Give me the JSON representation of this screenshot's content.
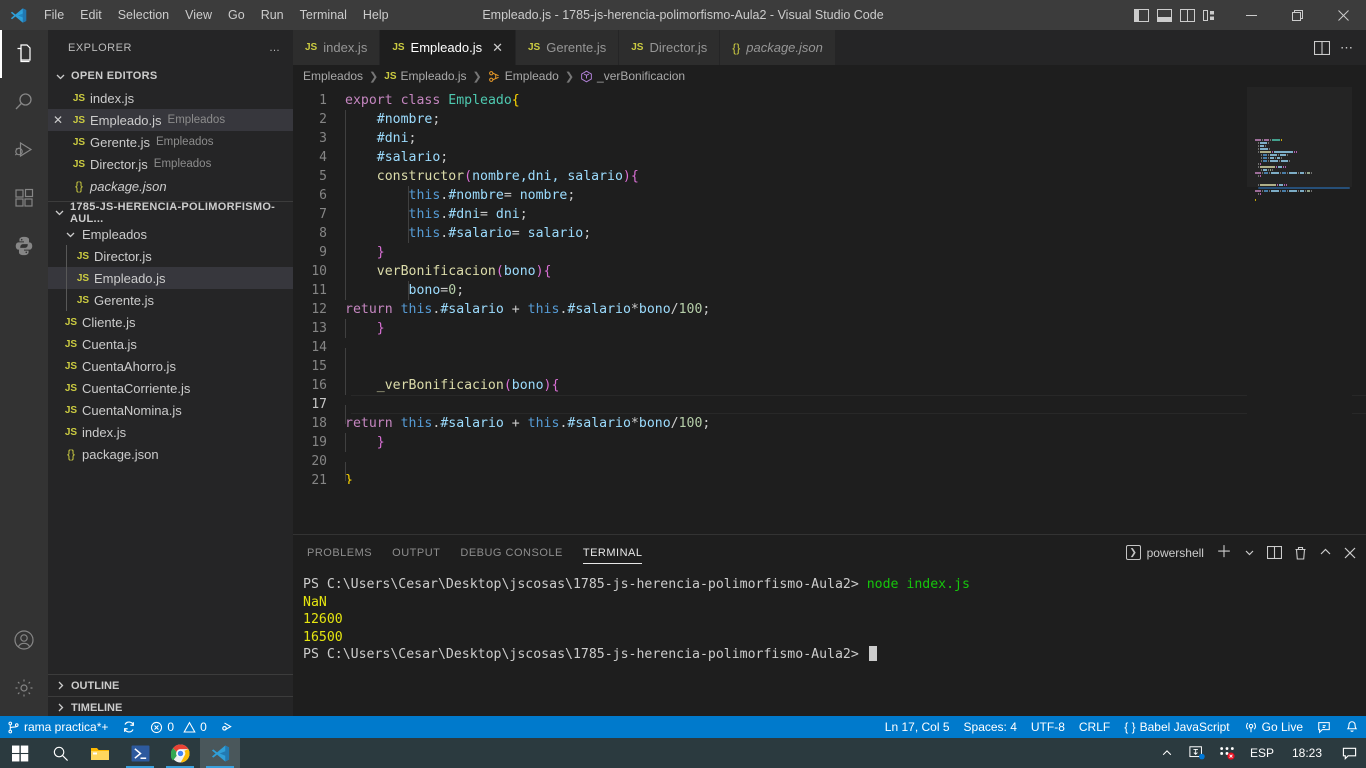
{
  "titlebar": {
    "menus": [
      "File",
      "Edit",
      "Selection",
      "View",
      "Go",
      "Run",
      "Terminal",
      "Help"
    ],
    "window_title": "Empleado.js - 1785-js-herencia-polimorfismo-Aula2 - Visual Studio Code",
    "layout_icons": [
      "toggle-primary-sidebar-icon",
      "toggle-panel-icon",
      "toggle-secondary-sidebar-icon",
      "customize-layout-icon"
    ],
    "window_controls": [
      "minimize",
      "restore",
      "close"
    ]
  },
  "activitybar": {
    "items": [
      {
        "name": "explorer",
        "icon": "files-icon",
        "active": true
      },
      {
        "name": "search",
        "icon": "search-icon",
        "active": false
      },
      {
        "name": "run-and-debug",
        "icon": "debug-icon",
        "active": false
      },
      {
        "name": "extensions",
        "icon": "extensions-icon",
        "active": false
      },
      {
        "name": "python",
        "icon": "python-icon",
        "active": false
      }
    ],
    "bottom": [
      {
        "name": "accounts",
        "icon": "account-icon"
      },
      {
        "name": "manage",
        "icon": "gear-icon"
      }
    ]
  },
  "sidebar": {
    "title": "EXPLORER",
    "more_actions": "…",
    "open_editors": {
      "label": "OPEN EDITORS",
      "items": [
        {
          "icon": "JS",
          "name": "index.js",
          "desc": "",
          "selected": false,
          "closable": false,
          "italic": false
        },
        {
          "icon": "JS",
          "name": "Empleado.js",
          "desc": "Empleados",
          "selected": true,
          "closable": true,
          "italic": false
        },
        {
          "icon": "JS",
          "name": "Gerente.js",
          "desc": "Empleados",
          "selected": false,
          "closable": false,
          "italic": false
        },
        {
          "icon": "JS",
          "name": "Director.js",
          "desc": "Empleados",
          "selected": false,
          "closable": false,
          "italic": false
        },
        {
          "icon": "{}",
          "name": "package.json",
          "desc": "",
          "selected": false,
          "closable": false,
          "italic": true
        }
      ]
    },
    "workspace": {
      "label": "1785-JS-HERENCIA-POLIMORFISMO-AUL...",
      "items": [
        {
          "type": "folder",
          "icon": "chevron-down-icon",
          "name": "Empleados",
          "indent": 1,
          "selected": false
        },
        {
          "type": "file",
          "icon": "JS",
          "name": "Director.js",
          "indent": 2,
          "selected": false
        },
        {
          "type": "file",
          "icon": "JS",
          "name": "Empleado.js",
          "indent": 2,
          "selected": true
        },
        {
          "type": "file",
          "icon": "JS",
          "name": "Gerente.js",
          "indent": 2,
          "selected": false
        },
        {
          "type": "file",
          "icon": "JS",
          "name": "Cliente.js",
          "indent": 1,
          "selected": false
        },
        {
          "type": "file",
          "icon": "JS",
          "name": "Cuenta.js",
          "indent": 1,
          "selected": false
        },
        {
          "type": "file",
          "icon": "JS",
          "name": "CuentaAhorro.js",
          "indent": 1,
          "selected": false
        },
        {
          "type": "file",
          "icon": "JS",
          "name": "CuentaCorriente.js",
          "indent": 1,
          "selected": false
        },
        {
          "type": "file",
          "icon": "JS",
          "name": "CuentaNomina.js",
          "indent": 1,
          "selected": false
        },
        {
          "type": "file",
          "icon": "JS",
          "name": "index.js",
          "indent": 1,
          "selected": false
        },
        {
          "type": "file",
          "icon": "{}",
          "name": "package.json",
          "indent": 1,
          "selected": false
        }
      ]
    },
    "collapsed_sections": [
      "OUTLINE",
      "TIMELINE"
    ]
  },
  "editor": {
    "tabs": [
      {
        "icon": "JS",
        "label": "index.js",
        "active": false,
        "dirty": false,
        "italic": false
      },
      {
        "icon": "JS",
        "label": "Empleado.js",
        "active": true,
        "dirty": false,
        "italic": false,
        "close": "✕"
      },
      {
        "icon": "JS",
        "label": "Gerente.js",
        "active": false,
        "dirty": false,
        "italic": false
      },
      {
        "icon": "JS",
        "label": "Director.js",
        "active": false,
        "dirty": false,
        "italic": false
      },
      {
        "icon": "{}",
        "label": "package.json",
        "active": false,
        "dirty": false,
        "italic": true
      }
    ],
    "tab_actions": [
      "split-editor-icon",
      "more-actions-icon"
    ],
    "breadcrumbs": [
      {
        "icon": "",
        "label": "Empleados"
      },
      {
        "icon": "JS",
        "label": "Empleado.js"
      },
      {
        "icon": "class-icon",
        "label": "Empleado"
      },
      {
        "icon": "method-icon",
        "label": "_verBonificacion"
      }
    ],
    "current_line": 17,
    "lines": [
      {
        "n": 1,
        "indent": 0,
        "tokens": [
          {
            "t": "export",
            "c": "k"
          },
          {
            "t": " ",
            "c": "pun"
          },
          {
            "t": "class",
            "c": "k"
          },
          {
            "t": " ",
            "c": "pun"
          },
          {
            "t": "Empleado",
            "c": "cls"
          },
          {
            "t": "{",
            "c": "br1"
          }
        ]
      },
      {
        "n": 2,
        "indent": 1,
        "tokens": [
          {
            "t": "    ",
            "c": "pun"
          },
          {
            "t": "#nombre",
            "c": "var"
          },
          {
            "t": ";",
            "c": "pun"
          }
        ]
      },
      {
        "n": 3,
        "indent": 1,
        "tokens": [
          {
            "t": "    ",
            "c": "pun"
          },
          {
            "t": "#dni",
            "c": "var"
          },
          {
            "t": ";",
            "c": "pun"
          }
        ]
      },
      {
        "n": 4,
        "indent": 1,
        "tokens": [
          {
            "t": "    ",
            "c": "pun"
          },
          {
            "t": "#salario",
            "c": "var"
          },
          {
            "t": ";",
            "c": "pun"
          }
        ]
      },
      {
        "n": 5,
        "indent": 1,
        "tokens": [
          {
            "t": "    ",
            "c": "pun"
          },
          {
            "t": "constructor",
            "c": "fn"
          },
          {
            "t": "(",
            "c": "br2"
          },
          {
            "t": "nombre,dni, salario",
            "c": "var"
          },
          {
            "t": ")",
            "c": "br2"
          },
          {
            "t": "{",
            "c": "br2"
          }
        ]
      },
      {
        "n": 6,
        "indent": 2,
        "tokens": [
          {
            "t": "        ",
            "c": "pun"
          },
          {
            "t": "this",
            "c": "kb"
          },
          {
            "t": ".",
            "c": "pun"
          },
          {
            "t": "#nombre",
            "c": "var"
          },
          {
            "t": "= ",
            "c": "pun"
          },
          {
            "t": "nombre",
            "c": "var"
          },
          {
            "t": ";",
            "c": "pun"
          }
        ]
      },
      {
        "n": 7,
        "indent": 2,
        "tokens": [
          {
            "t": "        ",
            "c": "pun"
          },
          {
            "t": "this",
            "c": "kb"
          },
          {
            "t": ".",
            "c": "pun"
          },
          {
            "t": "#dni",
            "c": "var"
          },
          {
            "t": "= ",
            "c": "pun"
          },
          {
            "t": "dni",
            "c": "var"
          },
          {
            "t": ";",
            "c": "pun"
          }
        ]
      },
      {
        "n": 8,
        "indent": 2,
        "tokens": [
          {
            "t": "        ",
            "c": "pun"
          },
          {
            "t": "this",
            "c": "kb"
          },
          {
            "t": ".",
            "c": "pun"
          },
          {
            "t": "#salario",
            "c": "var"
          },
          {
            "t": "= ",
            "c": "pun"
          },
          {
            "t": "salario",
            "c": "var"
          },
          {
            "t": ";",
            "c": "pun"
          }
        ]
      },
      {
        "n": 9,
        "indent": 1,
        "tokens": [
          {
            "t": "    ",
            "c": "pun"
          },
          {
            "t": "}",
            "c": "br2"
          }
        ]
      },
      {
        "n": 10,
        "indent": 1,
        "tokens": [
          {
            "t": "    ",
            "c": "pun"
          },
          {
            "t": "verBonificacion",
            "c": "fn"
          },
          {
            "t": "(",
            "c": "br2"
          },
          {
            "t": "bono",
            "c": "var"
          },
          {
            "t": ")",
            "c": "br2"
          },
          {
            "t": "{",
            "c": "br2"
          }
        ]
      },
      {
        "n": 11,
        "indent": 2,
        "tokens": [
          {
            "t": "        ",
            "c": "pun"
          },
          {
            "t": "bono",
            "c": "var"
          },
          {
            "t": "=",
            "c": "pun"
          },
          {
            "t": "0",
            "c": "num"
          },
          {
            "t": ";",
            "c": "pun"
          }
        ]
      },
      {
        "n": 12,
        "indent": 0,
        "tokens": [
          {
            "t": "return",
            "c": "k"
          },
          {
            "t": " ",
            "c": "pun"
          },
          {
            "t": "this",
            "c": "kb"
          },
          {
            "t": ".",
            "c": "pun"
          },
          {
            "t": "#salario",
            "c": "var"
          },
          {
            "t": " + ",
            "c": "pun"
          },
          {
            "t": "this",
            "c": "kb"
          },
          {
            "t": ".",
            "c": "pun"
          },
          {
            "t": "#salario",
            "c": "var"
          },
          {
            "t": "*",
            "c": "pun"
          },
          {
            "t": "bono",
            "c": "var"
          },
          {
            "t": "/",
            "c": "pun"
          },
          {
            "t": "100",
            "c": "num"
          },
          {
            "t": ";",
            "c": "pun"
          }
        ]
      },
      {
        "n": 13,
        "indent": 1,
        "tokens": [
          {
            "t": "    ",
            "c": "pun"
          },
          {
            "t": "}",
            "c": "br2"
          }
        ]
      },
      {
        "n": 14,
        "indent": 1,
        "tokens": []
      },
      {
        "n": 15,
        "indent": 1,
        "tokens": []
      },
      {
        "n": 16,
        "indent": 1,
        "tokens": [
          {
            "t": "    ",
            "c": "pun"
          },
          {
            "t": "_verBonificacion",
            "c": "fn"
          },
          {
            "t": "(",
            "c": "br2"
          },
          {
            "t": "bono",
            "c": "var"
          },
          {
            "t": ")",
            "c": "br2"
          },
          {
            "t": "{",
            "c": "br2"
          }
        ]
      },
      {
        "n": 17,
        "indent": 1,
        "tokens": [],
        "current": true
      },
      {
        "n": 18,
        "indent": 0,
        "tokens": [
          {
            "t": "return",
            "c": "k"
          },
          {
            "t": " ",
            "c": "pun"
          },
          {
            "t": "this",
            "c": "kb"
          },
          {
            "t": ".",
            "c": "pun"
          },
          {
            "t": "#salario",
            "c": "var"
          },
          {
            "t": " + ",
            "c": "pun"
          },
          {
            "t": "this",
            "c": "kb"
          },
          {
            "t": ".",
            "c": "pun"
          },
          {
            "t": "#salario",
            "c": "var"
          },
          {
            "t": "*",
            "c": "pun"
          },
          {
            "t": "bono",
            "c": "var"
          },
          {
            "t": "/",
            "c": "pun"
          },
          {
            "t": "100",
            "c": "num"
          },
          {
            "t": ";",
            "c": "pun"
          }
        ]
      },
      {
        "n": 19,
        "indent": 1,
        "tokens": [
          {
            "t": "    ",
            "c": "pun"
          },
          {
            "t": "}",
            "c": "br2"
          }
        ]
      },
      {
        "n": 20,
        "indent": 1,
        "tokens": []
      },
      {
        "n": 21,
        "indent": 0,
        "tokens": [
          {
            "t": "}",
            "c": "br1"
          }
        ]
      }
    ]
  },
  "panel": {
    "tabs": [
      "PROBLEMS",
      "OUTPUT",
      "DEBUG CONSOLE",
      "TERMINAL"
    ],
    "active_tab": "TERMINAL",
    "shell": "powershell",
    "actions": [
      "new-terminal-icon",
      "chevron-down-icon",
      "split-terminal-icon",
      "kill-terminal-icon",
      "maximize-panel-icon",
      "close-panel-icon"
    ],
    "terminal_lines": [
      [
        {
          "t": "PS C:\\Users\\Cesar\\Desktop\\jscosas\\1785-js-herencia-polimorfismo-Aula2> ",
          "c": ""
        },
        {
          "t": "node index.js",
          "c": "green"
        }
      ],
      [
        {
          "t": "NaN",
          "c": "yellow"
        }
      ],
      [
        {
          "t": "12600",
          "c": "yellow"
        }
      ],
      [
        {
          "t": "16500",
          "c": "yellow"
        }
      ],
      [
        {
          "t": "PS C:\\Users\\Cesar\\Desktop\\jscosas\\1785-js-herencia-polimorfismo-Aula2> ",
          "c": ""
        }
      ]
    ]
  },
  "statusbar": {
    "branch": "rama practica*+",
    "sync_icon": "sync-icon",
    "errors": "0",
    "warnings": "0",
    "ports_icon": "ports-icon",
    "position": "Ln 17, Col 5",
    "indentation": "Spaces: 4",
    "encoding": "UTF-8",
    "eol": "CRLF",
    "language": "Babel JavaScript",
    "golive": "Go Live",
    "feedback_icon": "feedback-icon",
    "bell_icon": "bell-icon",
    "accent": "#007acc"
  },
  "taskbar": {
    "buttons": [
      "start-icon",
      "search-icon",
      "file-explorer-icon",
      "powershell-icon",
      "chrome-icon",
      "vscode-icon"
    ],
    "tray": [
      "show-hidden-icons-icon",
      "onedrive-icon",
      "network-icon"
    ],
    "language": "ESP",
    "time": "18:23",
    "notification_icon": "action-center-icon"
  }
}
